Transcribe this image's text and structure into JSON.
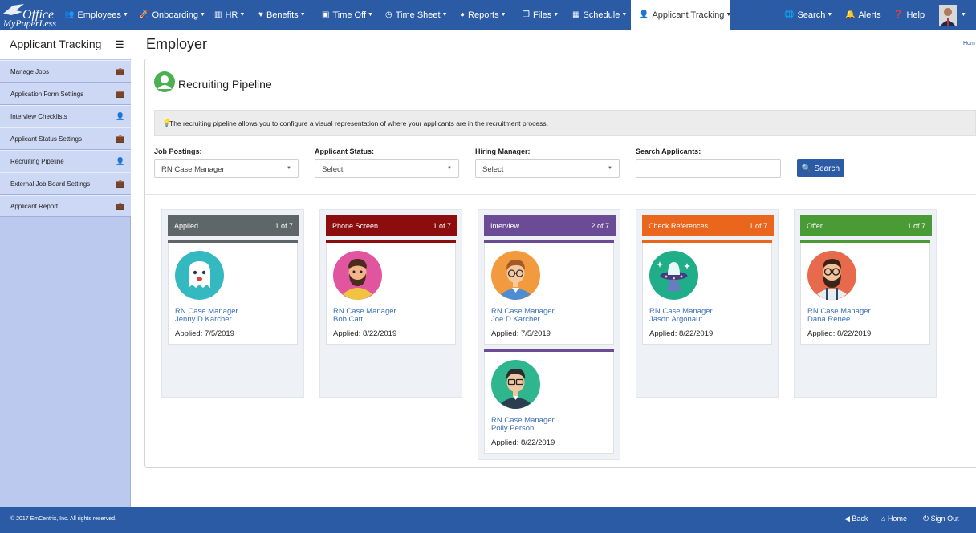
{
  "brand": {
    "line1": "Office",
    "line2": "MyPaperLess"
  },
  "nav": {
    "items": [
      {
        "label": "Employees",
        "icon": "users-icon"
      },
      {
        "label": "Onboarding",
        "icon": "rocket-icon"
      },
      {
        "label": "HR",
        "icon": "building-icon"
      },
      {
        "label": "Benefits",
        "icon": "heart-icon"
      },
      {
        "label": "Time Off",
        "icon": "suitcase-icon"
      },
      {
        "label": "Time Sheet",
        "icon": "clock-icon"
      },
      {
        "label": "Reports",
        "icon": "pie-chart-icon"
      },
      {
        "label": "Files",
        "icon": "files-icon"
      },
      {
        "label": "Schedule",
        "icon": "calendar-icon"
      },
      {
        "label": "Applicant Tracking",
        "icon": "user-plus-icon"
      }
    ],
    "right": [
      {
        "label": "Search",
        "icon": "globe-icon"
      },
      {
        "label": "Alerts",
        "icon": "bell-icon"
      },
      {
        "label": "Help",
        "icon": "question-icon"
      }
    ]
  },
  "sidebar": {
    "title": "Applicant Tracking",
    "items": [
      {
        "label": "Manage Jobs",
        "icon": "briefcase-icon"
      },
      {
        "label": "Application Form Settings",
        "icon": "briefcase-icon"
      },
      {
        "label": "Interview Checklists",
        "icon": "user-icon"
      },
      {
        "label": "Applicant Status Settings",
        "icon": "briefcase-icon"
      },
      {
        "label": "Recruiting Pipeline",
        "icon": "user-icon"
      },
      {
        "label": "External Job Board Settings",
        "icon": "briefcase-icon"
      },
      {
        "label": "Applicant Report",
        "icon": "briefcase-icon"
      }
    ]
  },
  "page": {
    "title": "Employer",
    "crumb": "Hom"
  },
  "panel": {
    "title": "Recruiting Pipeline",
    "info": "The recruiting pipeline allows you to configure a visual representation of where your applicants are in the recruitment process."
  },
  "filters": {
    "job_postings": {
      "label": "Job Postings:",
      "value": "RN Case Manager"
    },
    "applicant_status": {
      "label": "Applicant Status:",
      "value": "Select"
    },
    "hiring_manager": {
      "label": "Hiring Manager:",
      "value": "Select"
    },
    "search": {
      "label": "Search Applicants:",
      "value": "",
      "button": "Search"
    }
  },
  "columns": [
    {
      "name": "Applied",
      "count": "1 of 7",
      "color": "#5f6669",
      "cards": [
        {
          "job": "RN Case Manager",
          "name": "Jenny D Karcher",
          "date": "Applied: 7/5/2019",
          "avatar": "ghost"
        }
      ]
    },
    {
      "name": "Phone Screen",
      "count": "1 of 7",
      "color": "#8b0d0d",
      "cards": [
        {
          "job": "RN Case Manager",
          "name": "Bob Catt",
          "date": "Applied: 8/22/2019",
          "avatar": "bearded-man"
        }
      ]
    },
    {
      "name": "Interview",
      "count": "2 of 7",
      "color": "#6b4a96",
      "cards": [
        {
          "job": "RN Case Manager",
          "name": "Joe D Karcher",
          "date": "Applied: 7/5/2019",
          "avatar": "glasses-man"
        },
        {
          "job": "RN Case Manager",
          "name": "Polly Person",
          "date": "Applied: 8/22/2019",
          "avatar": "suit-man"
        }
      ]
    },
    {
      "name": "Check References",
      "count": "1 of 7",
      "color": "#e9661c",
      "cards": [
        {
          "job": "RN Case Manager",
          "name": "Jason Argonaut",
          "date": "Applied: 8/22/2019",
          "avatar": "ufo"
        }
      ]
    },
    {
      "name": "Offer",
      "count": "1 of 7",
      "color": "#4a9a35",
      "cards": [
        {
          "job": "RN Case Manager",
          "name": "Dana Renee",
          "date": "Applied: 8/22/2019",
          "avatar": "hipster-man"
        }
      ]
    }
  ],
  "footer": {
    "copyright": "© 2017 EmCentrix, Inc. All rights reserved.",
    "back": "Back",
    "home": "Home",
    "signout": "Sign Out"
  }
}
